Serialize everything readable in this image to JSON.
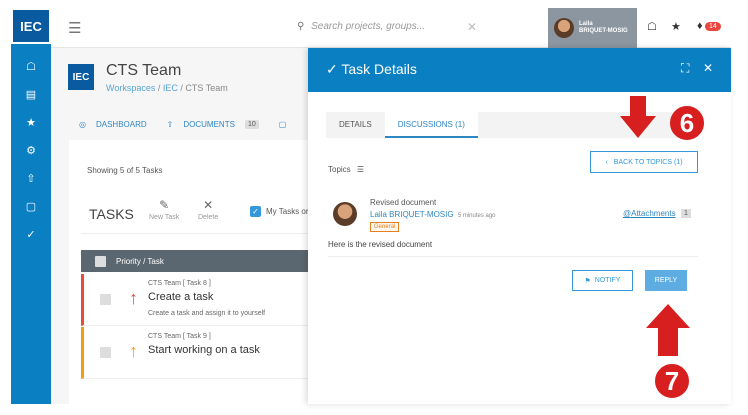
{
  "sidebar": {
    "logo": "IEC",
    "icons": [
      "home-icon",
      "table-icon",
      "star-icon",
      "gear-icon",
      "upload-icon",
      "chat-icon",
      "check-icon"
    ]
  },
  "topbar": {
    "search_placeholder": "Search projects, groups...",
    "user_first": "Laila",
    "user_last": "BRIQUET-MOSIG",
    "notif_count": "14"
  },
  "team": {
    "logo": "IEC",
    "title": "CTS Team",
    "crumb1": "Workspaces",
    "crumb2": "IEC",
    "crumb3": "CTS Team"
  },
  "subnav": {
    "dashboard": "DASHBOARD",
    "documents": "DOCUMENTS",
    "documents_count": "10"
  },
  "tasks": {
    "showing": "Showing 5 of 5 Tasks",
    "title": "TASKS",
    "new_task": "New Task",
    "delete": "Delete",
    "my_tasks": "My Tasks only",
    "header": "Priority / Task",
    "rows": [
      {
        "project": "CTS Team [ Task 8 ]",
        "title": "Create a task",
        "desc": "Create a task and assign it to yourself",
        "color": "#e74c3c"
      },
      {
        "project": "CTS Team [ Task 9 ]",
        "title": "Start working on a task",
        "desc": "",
        "color": "#f39c12"
      }
    ]
  },
  "modal": {
    "title": "Task Details",
    "tab_details": "DETAILS",
    "tab_discussions": "DISCUSSIONS (1)",
    "topics": "Topics",
    "back": "BACK TO TOPICS (1)",
    "post_title": "Revised document",
    "post_author": "Laila BRIQUET-MOSIG",
    "post_time": "5 minutes ago",
    "post_tag": "General",
    "attachments": "@Attachments",
    "attachments_count": "1",
    "post_body": "Here is the revised document",
    "notify": "NOTIFY",
    "reply": "REPLY"
  },
  "annotations": {
    "step6": "6",
    "step7": "7",
    "accent": "#d81f1f"
  }
}
